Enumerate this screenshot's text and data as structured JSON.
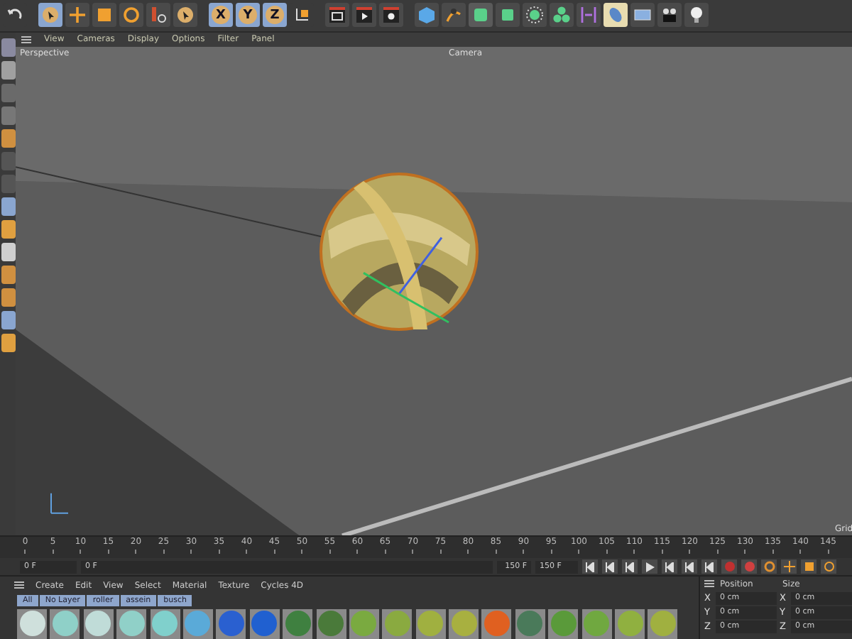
{
  "toolbar": {
    "axes": [
      {
        "label": "X",
        "on": true
      },
      {
        "label": "Y",
        "on": true
      },
      {
        "label": "Z",
        "on": true
      }
    ]
  },
  "viewport": {
    "menu": [
      "View",
      "Cameras",
      "Display",
      "Options",
      "Filter",
      "Panel"
    ],
    "view_name": "Perspective",
    "camera": "Camera",
    "corner": "Grid"
  },
  "timeline": {
    "ticks": [
      "0",
      "5",
      "10",
      "15",
      "20",
      "25",
      "30",
      "35",
      "40",
      "45",
      "50",
      "55",
      "60",
      "65",
      "70",
      "75",
      "80",
      "85",
      "90",
      "95",
      "100",
      "105",
      "110",
      "115",
      "120",
      "125",
      "130",
      "135",
      "140",
      "145"
    ],
    "start": "0 F",
    "current": "0 F",
    "end": "150 F",
    "max": "150 F"
  },
  "materials": {
    "menu": [
      "Create",
      "Edit",
      "View",
      "Select",
      "Material",
      "Texture",
      "Cycles 4D"
    ],
    "layers": [
      "All",
      "No Layer",
      "roller",
      "assein",
      "busch"
    ],
    "items": [
      {
        "color": "#cfe0dc"
      },
      {
        "color": "#8fd0c8"
      },
      {
        "color": "#c0dcd8"
      },
      {
        "color": "#90d0c8"
      },
      {
        "color": "#80d0cc"
      },
      {
        "color": "#5aaad8"
      },
      {
        "color": "#2a60d0"
      },
      {
        "color": "#2060d0"
      },
      {
        "color": "#3f8040"
      },
      {
        "color": "#4a7a3a"
      },
      {
        "color": "#7aaa40"
      },
      {
        "color": "#8aaa40"
      },
      {
        "color": "#a0b040"
      },
      {
        "color": "#a8b040"
      },
      {
        "color": "#e06020"
      },
      {
        "color": "#4a7a5a"
      },
      {
        "color": "#5a9a3a"
      },
      {
        "color": "#70a840"
      },
      {
        "color": "#90b040"
      },
      {
        "color": "#a0b040"
      }
    ]
  },
  "coordinates": {
    "position_header": "Position",
    "size_header": "Size",
    "rows": [
      {
        "axis": "X",
        "position": "0 cm",
        "size_axis": "X",
        "size": "0 cm"
      },
      {
        "axis": "Y",
        "position": "0 cm",
        "size_axis": "Y",
        "size": "0 cm"
      },
      {
        "axis": "Z",
        "position": "0 cm",
        "size_axis": "Z",
        "size": "0 cm"
      }
    ]
  }
}
